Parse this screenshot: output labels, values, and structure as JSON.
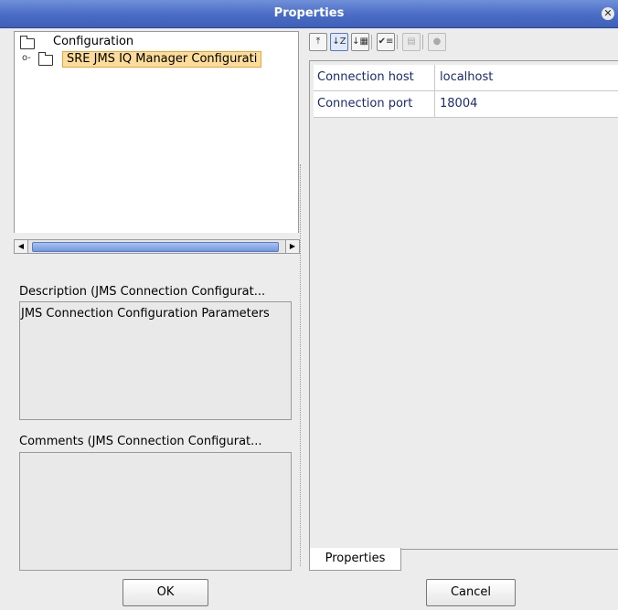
{
  "window": {
    "title": "Properties",
    "close_icon": "close-icon"
  },
  "tree": {
    "root_label": "Configuration",
    "child_label": "SRE JMS IQ Manager Configurati"
  },
  "description": {
    "label": "Description (JMS Connection Configurat...",
    "text": "JMS Connection Configuration Parameters"
  },
  "comments": {
    "label": "Comments (JMS Connection Configurat...",
    "text": ""
  },
  "toolbar": {
    "icons": [
      "collapse-icon",
      "sort-az-icon",
      "sort-category-icon",
      "checklist-icon",
      "grid-icon",
      "help-icon"
    ]
  },
  "properties": [
    {
      "key": "Connection host",
      "value": "localhost"
    },
    {
      "key": "Connection port",
      "value": "18004"
    }
  ],
  "tab_label": "Properties",
  "buttons": {
    "ok": "OK",
    "cancel": "Cancel"
  }
}
